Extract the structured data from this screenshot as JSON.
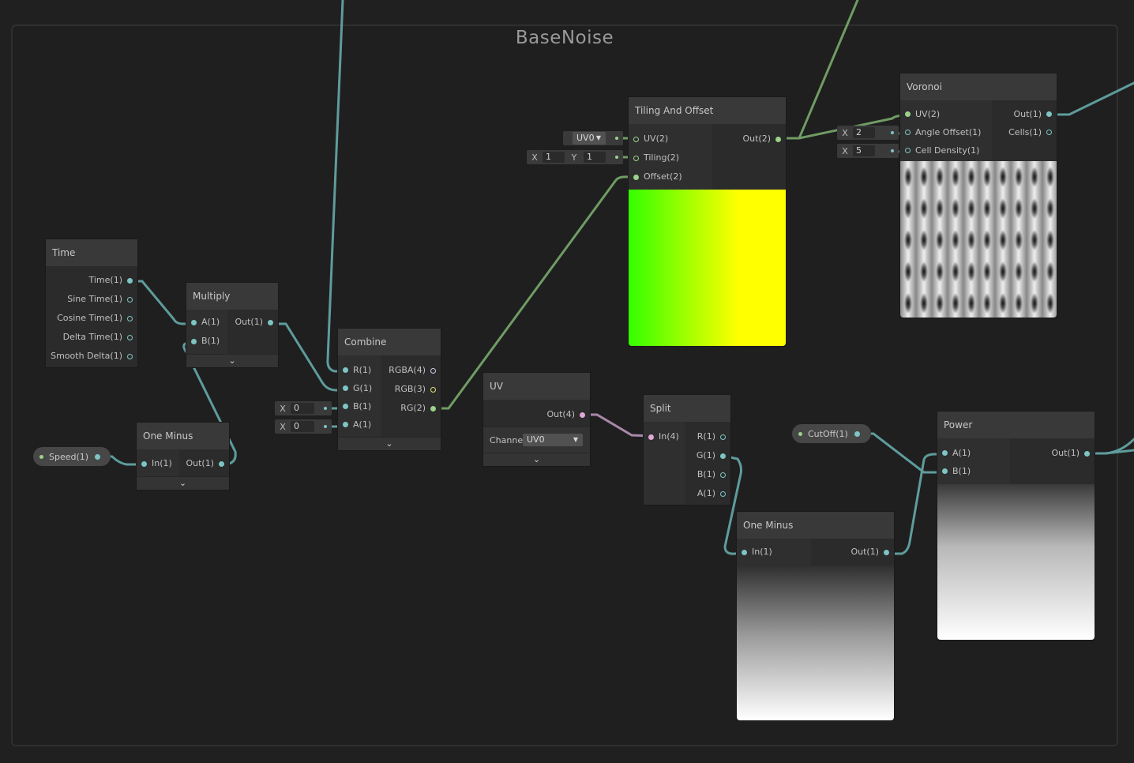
{
  "group": {
    "title": "BaseNoise"
  },
  "colors": {
    "background": "#202020",
    "float_wire": "#5f9c9c",
    "vector2_wire": "#6f9c64",
    "vector4_wire": "#a888a8"
  },
  "icons": {
    "expand": "chevron-down-icon",
    "dropdown": "caret-down-icon"
  },
  "properties": {
    "speed": {
      "label": "Speed(1)"
    },
    "cutoff": {
      "label": "CutOff(1)"
    }
  },
  "nodes": {
    "time": {
      "title": "Time",
      "outputs": [
        "Time(1)",
        "Sine Time(1)",
        "Cosine Time(1)",
        "Delta Time(1)",
        "Smooth Delta(1)"
      ]
    },
    "multiply": {
      "title": "Multiply",
      "inputs": [
        "A(1)",
        "B(1)"
      ],
      "outputs": [
        "Out(1)"
      ],
      "expand": "⌄"
    },
    "one_minus_a": {
      "title": "One Minus",
      "inputs": [
        "In(1)"
      ],
      "outputs": [
        "Out(1)"
      ],
      "expand": "⌄"
    },
    "combine": {
      "title": "Combine",
      "inputs": [
        "R(1)",
        "G(1)",
        "B(1)",
        "A(1)"
      ],
      "outputs": [
        "RGBA(4)",
        "RGB(3)",
        "RG(2)"
      ],
      "expand": "⌄",
      "b_field": {
        "axis": "X",
        "value": "0"
      },
      "a_field": {
        "axis": "X",
        "value": "0"
      }
    },
    "tiling_offset": {
      "title": "Tiling And Offset",
      "inputs": [
        "UV(2)",
        "Tiling(2)",
        "Offset(2)"
      ],
      "outputs": [
        "Out(2)"
      ],
      "uv_dropdown": "UV0",
      "tiling_field": {
        "x_axis": "X",
        "x_value": "1",
        "y_axis": "Y",
        "y_value": "1"
      }
    },
    "voronoi": {
      "title": "Voronoi",
      "inputs": [
        "UV(2)",
        "Angle Offset(1)",
        "Cell Density(1)"
      ],
      "outputs": [
        "Out(1)",
        "Cells(1)"
      ],
      "angle_field": {
        "axis": "X",
        "value": "2"
      },
      "density_field": {
        "axis": "X",
        "value": "5"
      }
    },
    "uv": {
      "title": "UV",
      "outputs": [
        "Out(4)"
      ],
      "channel_label": "Channe",
      "channel_value": "UV0",
      "expand": "⌄"
    },
    "split": {
      "title": "Split",
      "inputs": [
        "In(4)"
      ],
      "outputs": [
        "R(1)",
        "G(1)",
        "B(1)",
        "A(1)"
      ]
    },
    "one_minus_b": {
      "title": "One Minus",
      "inputs": [
        "In(1)"
      ],
      "outputs": [
        "Out(1)"
      ]
    },
    "power": {
      "title": "Power",
      "inputs": [
        "A(1)",
        "B(1)"
      ],
      "outputs": [
        "Out(1)"
      ]
    }
  }
}
